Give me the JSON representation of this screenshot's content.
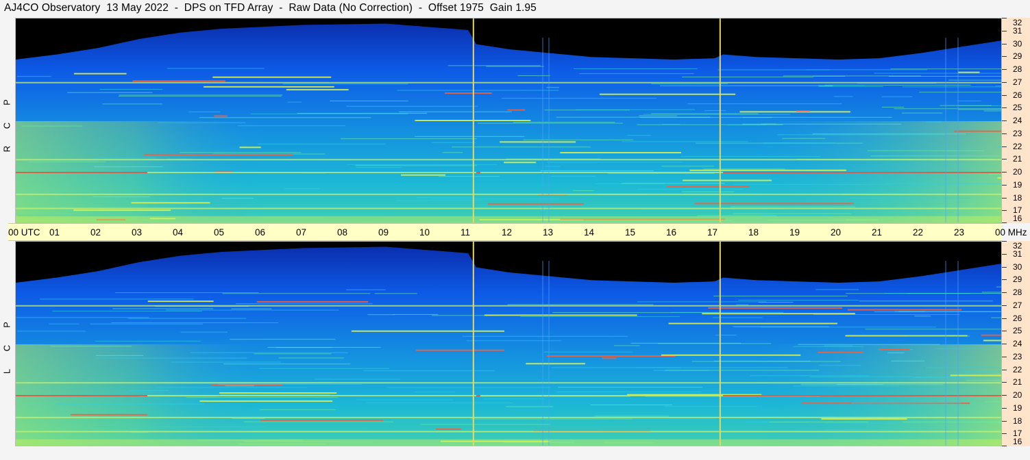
{
  "header": {
    "title": "AJ4CO Observatory  13 May 2022  -  DPS on TFD Array  -  Raw Data (No Correction)  -  Offset 1975  Gain 1.95"
  },
  "polarization": {
    "top": [
      "R",
      "C",
      "P"
    ],
    "bottom": [
      "L",
      "C",
      "P"
    ]
  },
  "time_axis": {
    "labels": [
      "00 UTC",
      "01",
      "02",
      "03",
      "04",
      "05",
      "06",
      "07",
      "08",
      "09",
      "10",
      "11",
      "12",
      "13",
      "14",
      "15",
      "16",
      "17",
      "18",
      "19",
      "20",
      "21",
      "22",
      "23",
      "00 MHz"
    ]
  },
  "frequency_axis": {
    "labels": [
      "32",
      "31",
      "30",
      "29",
      "28",
      "27",
      "26",
      "25",
      "24",
      "23",
      "22",
      "21",
      "20",
      "19",
      "18",
      "17",
      "16"
    ]
  },
  "colors": {
    "background_sky": "#0a4be0",
    "cutoff_black": "#000000",
    "intensity_mid": "#19b8d8",
    "intensity_high": "#d8f050",
    "time_axis_bg": "#ffffc6",
    "freq_axis_bg": "#ffe4cc",
    "marker_line": "#e8d860"
  },
  "chart_data": [
    {
      "type": "heatmap",
      "title": "AJ4CO Observatory  13 May 2022  -  DPS on TFD Array  -  Raw Data (No Correction)  -  Offset 1975  Gain 1.95",
      "panel": "RCP",
      "x_unit": "UTC hour",
      "x": [
        0,
        1,
        2,
        3,
        4,
        5,
        6,
        7,
        8,
        9,
        10,
        11,
        12,
        13,
        14,
        15,
        16,
        17,
        18,
        19,
        20,
        21,
        22,
        23,
        24
      ],
      "xlim": [
        0,
        24
      ],
      "y_unit": "MHz",
      "y": [
        16,
        17,
        18,
        19,
        20,
        21,
        22,
        23,
        24,
        25,
        26,
        27,
        28,
        29,
        30,
        31,
        32
      ],
      "ylim": [
        16,
        32
      ],
      "marker_times_utc": [
        11.13,
        17.13
      ],
      "bright_bands_mhz": [
        17.2,
        18.3,
        20.0,
        21.0,
        27.0
      ]
    },
    {
      "type": "heatmap",
      "title": "AJ4CO Observatory  13 May 2022  -  DPS on TFD Array  -  Raw Data (No Correction)  -  Offset 1975  Gain 1.95",
      "panel": "LCP",
      "x_unit": "UTC hour",
      "x": [
        0,
        1,
        2,
        3,
        4,
        5,
        6,
        7,
        8,
        9,
        10,
        11,
        12,
        13,
        14,
        15,
        16,
        17,
        18,
        19,
        20,
        21,
        22,
        23,
        24
      ],
      "xlim": [
        0,
        24
      ],
      "y_unit": "MHz",
      "y": [
        16,
        17,
        18,
        19,
        20,
        21,
        22,
        23,
        24,
        25,
        26,
        27,
        28,
        29,
        30,
        31,
        32
      ],
      "ylim": [
        16,
        32
      ],
      "marker_times_utc": [
        11.13,
        17.13
      ],
      "bright_bands_mhz": [
        17.2,
        18.3,
        20.0,
        21.0,
        27.0
      ]
    }
  ]
}
